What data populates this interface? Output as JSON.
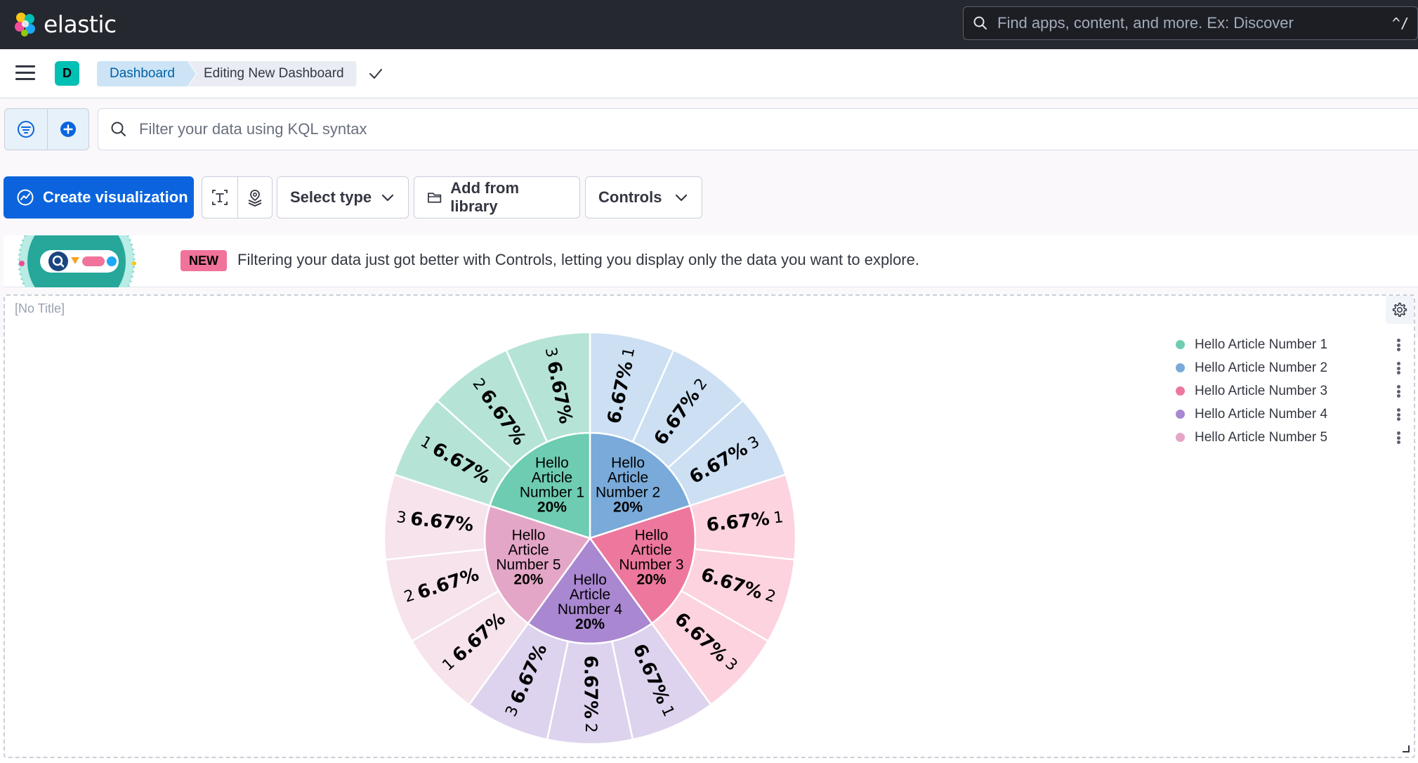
{
  "header": {
    "brand": "elastic",
    "search_placeholder": "Find apps, content, and more. Ex: Discover",
    "search_shortcut": "^/",
    "logo_icon": "elastic-logo",
    "search_icon": "search-icon"
  },
  "breadcrumbs": {
    "space_initial": "D",
    "items": [
      "Dashboard",
      "Editing New Dashboard"
    ],
    "menu_icon": "hamburger-icon",
    "confirm_icon": "check-icon"
  },
  "querybar": {
    "kql_placeholder": "Filter your data using KQL syntax",
    "filter_icon": "filter-icon",
    "add_filter_icon": "plus-circle-icon"
  },
  "toolbar": {
    "create_visualization": "Create visualization",
    "select_type": "Select type",
    "add_from_library": "Add from library",
    "controls": "Controls",
    "text_icon": "text-icon",
    "maps_icon": "maps-icon",
    "folder_icon": "folder-icon",
    "chevron_icon": "chevron-down-icon"
  },
  "callout": {
    "badge": "NEW",
    "text": "Filtering your data just got better with Controls, letting you display only the data you want to explore."
  },
  "panel": {
    "title": "[No Title]",
    "settings_icon": "gear-icon"
  },
  "legend": {
    "items": [
      {
        "label": "Hello Article Number 1",
        "color": "#6dccb1"
      },
      {
        "label": "Hello Article Number 2",
        "color": "#79aad9"
      },
      {
        "label": "Hello Article Number 3",
        "color": "#ee789d"
      },
      {
        "label": "Hello Article Number 4",
        "color": "#a987d1"
      },
      {
        "label": "Hello Article Number 5",
        "color": "#e4a6c7"
      }
    ]
  },
  "chart_data": {
    "type": "pie",
    "inner": [
      {
        "name": "Hello Article Number 1",
        "value": 20,
        "label": "20%",
        "color": "#6dccb1"
      },
      {
        "name": "Hello Article Number 2",
        "value": 20,
        "label": "20%",
        "color": "#79aad9"
      },
      {
        "name": "Hello Article Number 3",
        "value": 20,
        "label": "20%",
        "color": "#ee789d"
      },
      {
        "name": "Hello Article Number 4",
        "value": 20,
        "label": "20%",
        "color": "#a987d1"
      },
      {
        "name": "Hello Article Number 5",
        "value": 20,
        "label": "20%",
        "color": "#e4a6c7"
      }
    ],
    "outer": [
      {
        "parent": "Hello Article Number 1",
        "children": [
          "1",
          "2",
          "3"
        ],
        "value": 6.67,
        "label": "6.67%",
        "color": "#b5e4d6"
      },
      {
        "parent": "Hello Article Number 2",
        "children": [
          "1",
          "2",
          "3"
        ],
        "value": 6.67,
        "label": "6.67%",
        "color": "#ccdff3"
      },
      {
        "parent": "Hello Article Number 3",
        "children": [
          "1",
          "2",
          "3"
        ],
        "value": 6.67,
        "label": "6.67%",
        "color": "#fcd3df"
      },
      {
        "parent": "Hello Article Number 4",
        "children": [
          "1",
          "2",
          "3"
        ],
        "value": 6.67,
        "label": "6.67%",
        "color": "#ddd3ee"
      },
      {
        "parent": "Hello Article Number 5",
        "children": [
          "1",
          "2",
          "3"
        ],
        "value": 6.67,
        "label": "6.67%",
        "color": "#f6e3ec"
      }
    ]
  }
}
